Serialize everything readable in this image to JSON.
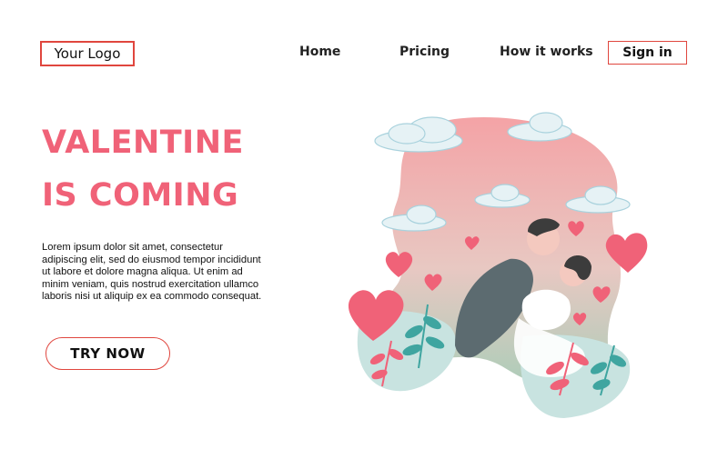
{
  "header": {
    "logo_label": "Your Logo",
    "nav": {
      "home": "Home",
      "pricing": "Pricing",
      "how_it_works": "How it works"
    },
    "sign_in_label": "Sign in"
  },
  "hero": {
    "headline_line1": "VALENTINE",
    "headline_line2": "IS COMING",
    "body_lines": [
      "Lorem ipsum dolor sit amet, consectetur",
      "adipiscing elit, sed do eiusmod tempor incididunt",
      "ut labore et dolore magna aliqua. Ut enim ad",
      "minim veniam, quis nostrud exercitation ullamco",
      "laboris nisi ut aliquip ex ea commodo consequat."
    ],
    "cta_label": "TRY NOW"
  },
  "colors": {
    "accent": "#e0463e",
    "headline": "#f06278",
    "heart": "#f06278",
    "leaf": "#3fa5a0",
    "cloud": "#e6f2f5"
  }
}
